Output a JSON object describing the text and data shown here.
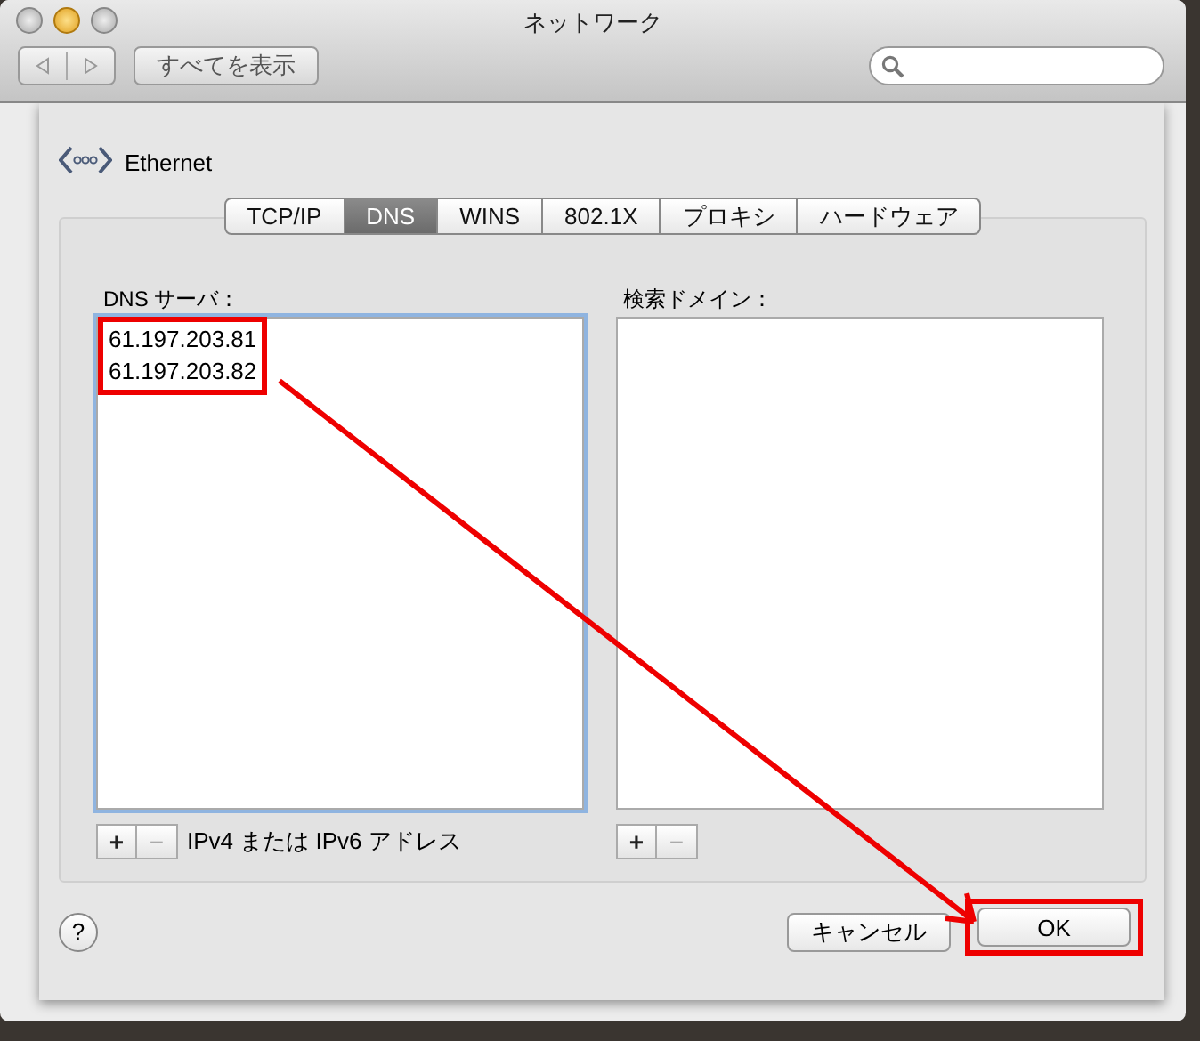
{
  "window": {
    "title": "ネットワーク",
    "show_all_button": "すべてを表示"
  },
  "service": {
    "name": "Ethernet"
  },
  "tabs": [
    {
      "label": "TCP/IP",
      "selected": false
    },
    {
      "label": "DNS",
      "selected": true
    },
    {
      "label": "WINS",
      "selected": false
    },
    {
      "label": "802.1X",
      "selected": false
    },
    {
      "label": "プロキシ",
      "selected": false
    },
    {
      "label": "ハードウェア",
      "selected": false
    }
  ],
  "dns_servers": {
    "label": "DNS サーバ：",
    "entries": [
      "61.197.203.81",
      "61.197.203.82"
    ],
    "add_button": "+",
    "remove_button": "−",
    "hint": "IPv4 または IPv6 アドレス"
  },
  "search_domains": {
    "label": "検索ドメイン：",
    "add_button": "+",
    "remove_button": "−"
  },
  "help_button": "?",
  "buttons": [
    {
      "label": "キャンセル",
      "kind": "cancel"
    },
    {
      "label": "OK",
      "kind": "default"
    }
  ]
}
